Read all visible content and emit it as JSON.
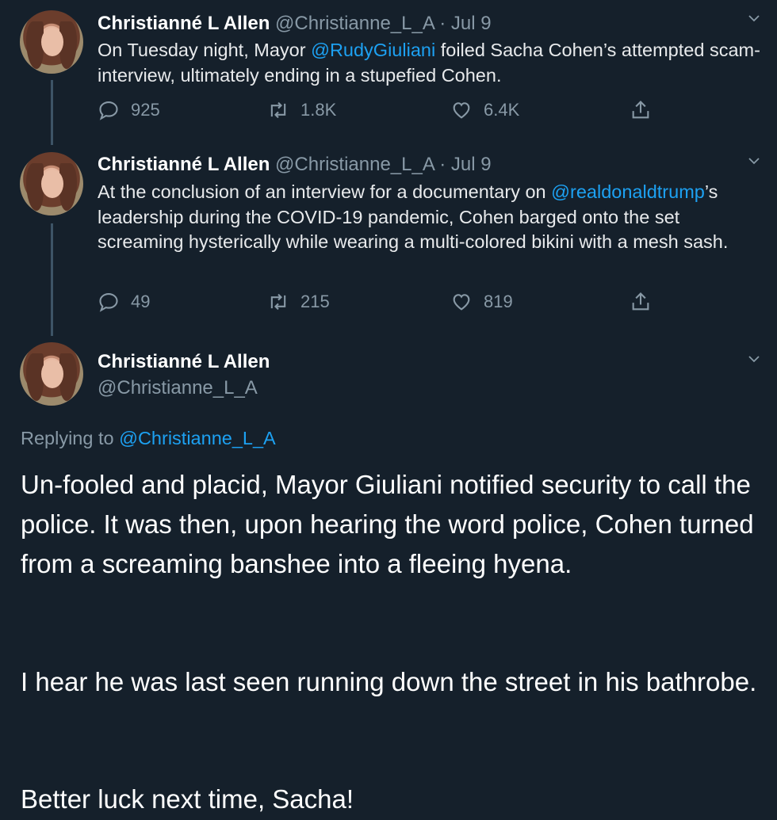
{
  "tweets": [
    {
      "name": "Christianné L Allen",
      "handle": "@Christianne_L_A",
      "sep": "·",
      "date": "Jul 9",
      "text_pre": "On Tuesday night, Mayor ",
      "mention": "@RudyGiuliani",
      "text_post": " foiled Sacha Cohen’s attempted scam-interview, ultimately ending in a stupefied Cohen.",
      "replies": "925",
      "retweets": "1.8K",
      "likes": "6.4K"
    },
    {
      "name": "Christianné L Allen",
      "handle": "@Christianne_L_A",
      "sep": "·",
      "date": "Jul 9",
      "text_pre": "At the conclusion of an interview for a documentary on ",
      "mention": "@realdonaldtrump",
      "text_post": "’s leadership during the COVID-19 pandemic, Cohen barged onto the set screaming hysterically while wearing a multi-colored bikini with a mesh sash.",
      "replies": "49",
      "retweets": "215",
      "likes": "819"
    }
  ],
  "main_tweet": {
    "name": "Christianné L Allen",
    "handle": "@Christianne_L_A",
    "replying_label": "Replying to ",
    "replying_handle": "@Christianne_L_A",
    "paragraph1": "Un-fooled and placid, Mayor Giuliani notified security to call the police. It was then, upon hearing the word police, Cohen turned from a screaming banshee into a fleeing hyena.",
    "paragraph2": "I hear he was last seen running down the street in his bathrobe.",
    "paragraph3": "Better luck next time, Sacha!"
  },
  "icons": {
    "reply": "reply-icon",
    "retweet": "retweet-icon",
    "like": "heart-icon",
    "share": "share-icon",
    "more": "chevron-down-icon"
  },
  "colors": {
    "background": "#15202b",
    "link": "#1da1f2",
    "muted": "#8899a6"
  }
}
